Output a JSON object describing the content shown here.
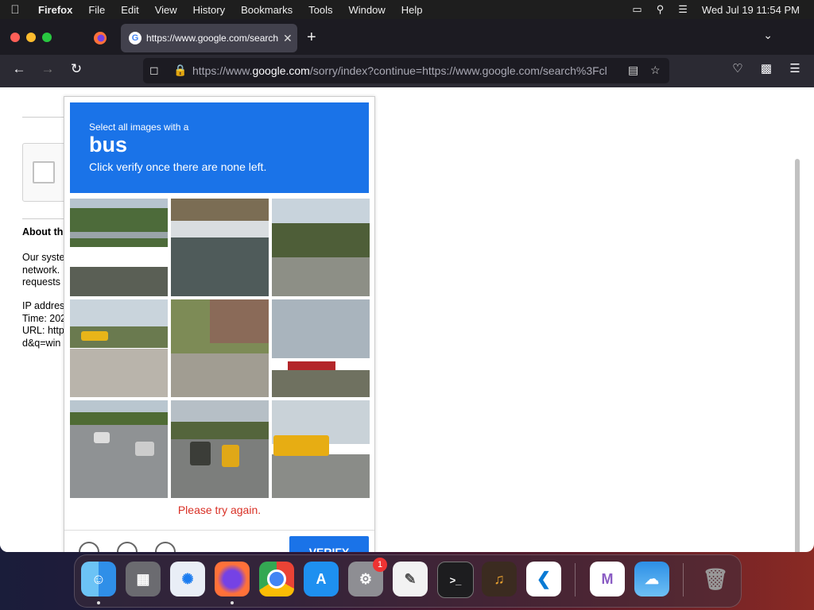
{
  "menubar": {
    "apple_icon": "apple-icon",
    "app_name": "Firefox",
    "items": [
      "File",
      "Edit",
      "View",
      "History",
      "Bookmarks",
      "Tools",
      "Window",
      "Help"
    ],
    "clock": "Wed Jul 19  11:54 PM"
  },
  "browser": {
    "tab_title": "https://www.google.com/search",
    "tab_favicon": "G",
    "url_host_prefix": "https://www.",
    "url_host": "google.com",
    "url_rest": "/sorry/index?continue=https://www.google.com/search%3Fcl"
  },
  "page": {
    "about_title": "About th",
    "about_lines": [
      "Our syste",
      "network.",
      "requests"
    ],
    "meta_lines": [
      "IP addres",
      "Time: 202",
      "URL: http",
      "d&q=win"
    ]
  },
  "captcha": {
    "instruction": "Select all images with a",
    "target": "bus",
    "subtitle": "Click verify once there are none left.",
    "error": "Please try again.",
    "verify_label": "VERIFY",
    "accent": "#1a73e8",
    "error_color": "#d93025"
  },
  "dock": {
    "apps": [
      "Finder",
      "Launchpad",
      "Safari",
      "Firefox",
      "Chrome",
      "App Store",
      "System Settings",
      "TextEdit",
      "Terminal",
      "GarageBand",
      "Visual Studio Code",
      "Visual Studio",
      "Weather",
      "Trash"
    ],
    "settings_badge": "1"
  }
}
